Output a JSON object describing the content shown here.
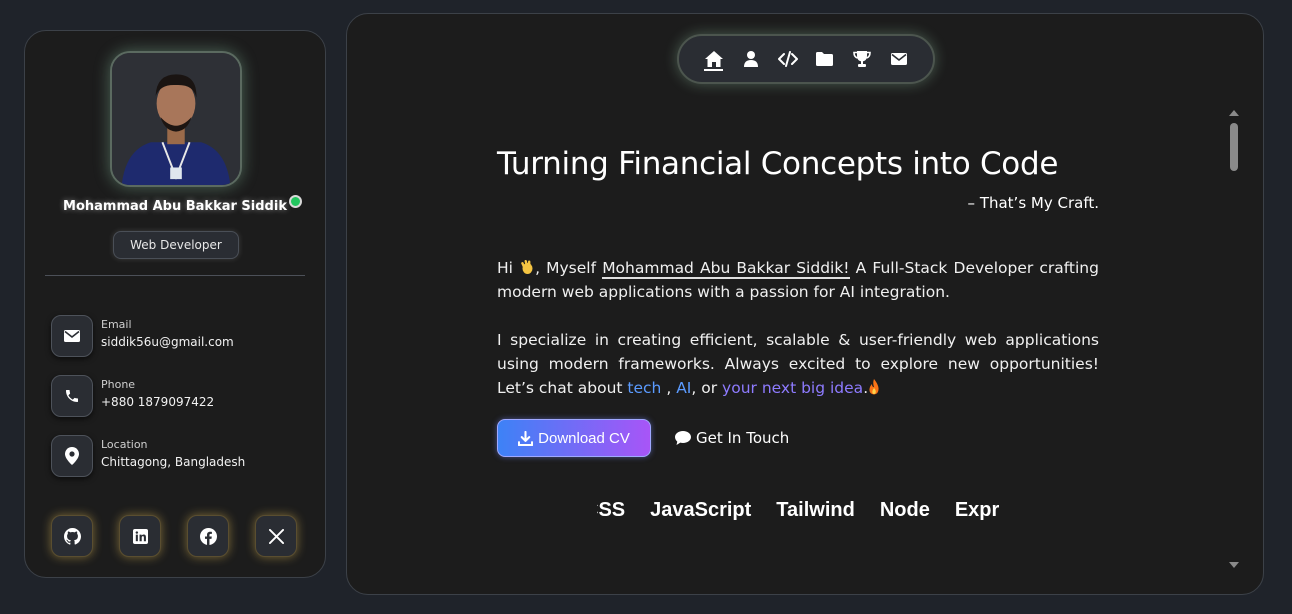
{
  "profile": {
    "name": "Mohammad Abu Bakkar Siddik",
    "role": "Web Developer",
    "status": "online"
  },
  "contacts": [
    {
      "label": "Email",
      "value": "siddik56u@gmail.com",
      "icon": "envelope-icon"
    },
    {
      "label": "Phone",
      "value": "+880 1879097422",
      "icon": "phone-icon"
    },
    {
      "label": "Location",
      "value": "Chittagong, Bangladesh",
      "icon": "map-pin-icon"
    }
  ],
  "social": [
    "github-icon",
    "linkedin-icon",
    "facebook-icon",
    "x-icon"
  ],
  "nav": {
    "items": [
      "home-icon",
      "user-icon",
      "code-icon",
      "folder-icon",
      "trophy-icon",
      "mail-icon"
    ],
    "active": "home-icon"
  },
  "hero": {
    "title": "Turning Financial Concepts into Code",
    "subtitle": "– That’s My Craft.",
    "intro": {
      "hi": "Hi",
      "myself": ", Myself",
      "name": "Mohammad Abu Bakkar Siddik!",
      "rest": "A Full-Stack Developer crafting modern web applications with a passion for AI integration."
    },
    "para2": {
      "text": "I specialize in creating efficient, scalable & user-friendly web applications using modern frameworks. Always excited to explore new opportunities! Let’s chat about",
      "tech": "tech",
      "comma": ",",
      "ai": "AI",
      "or": ", or",
      "idea": "your next big idea",
      "period": "."
    }
  },
  "buttons": {
    "download_cv": "Download CV",
    "get_in_touch": "Get In Touch"
  },
  "skills": [
    "CSS",
    "JavaScript",
    "Tailwind",
    "Node",
    "Express"
  ],
  "colors": {
    "accent_blue": "#3d82f6",
    "accent_purple": "#a855f7",
    "online": "#22c55e",
    "link": "#5b9bff"
  }
}
